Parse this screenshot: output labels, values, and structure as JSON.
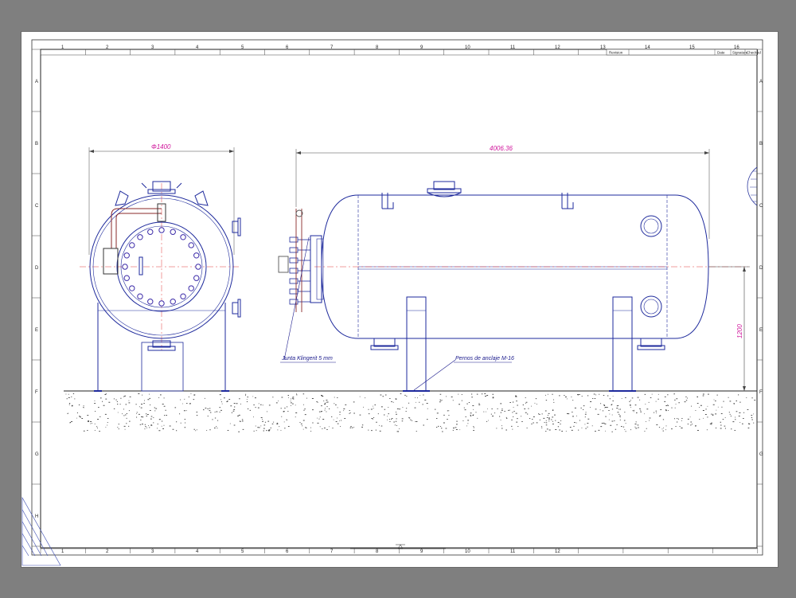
{
  "drawing": {
    "column_numbers_top": [
      "1",
      "2",
      "3",
      "4",
      "5",
      "6",
      "7",
      "8",
      "9",
      "10",
      "11",
      "12",
      "13",
      "14",
      "15",
      "16"
    ],
    "column_numbers_bottom": [
      "1",
      "2",
      "3",
      "4",
      "5",
      "6",
      "7",
      "8",
      "9",
      "10",
      "11",
      "12"
    ],
    "row_letters": [
      "A",
      "B",
      "C",
      "D",
      "E",
      "F",
      "G",
      "H"
    ],
    "title_block": {
      "col1": "Revision",
      "col2": "Date",
      "col3": "Signature",
      "col4": "Checked"
    },
    "dimensions": {
      "diameter": "Φ1400",
      "length": "4006.36",
      "height": "1200"
    },
    "notes": {
      "gasket": "Junta Klingerit  5 mm",
      "bolts": "Pernos de anclaje M-16"
    }
  }
}
